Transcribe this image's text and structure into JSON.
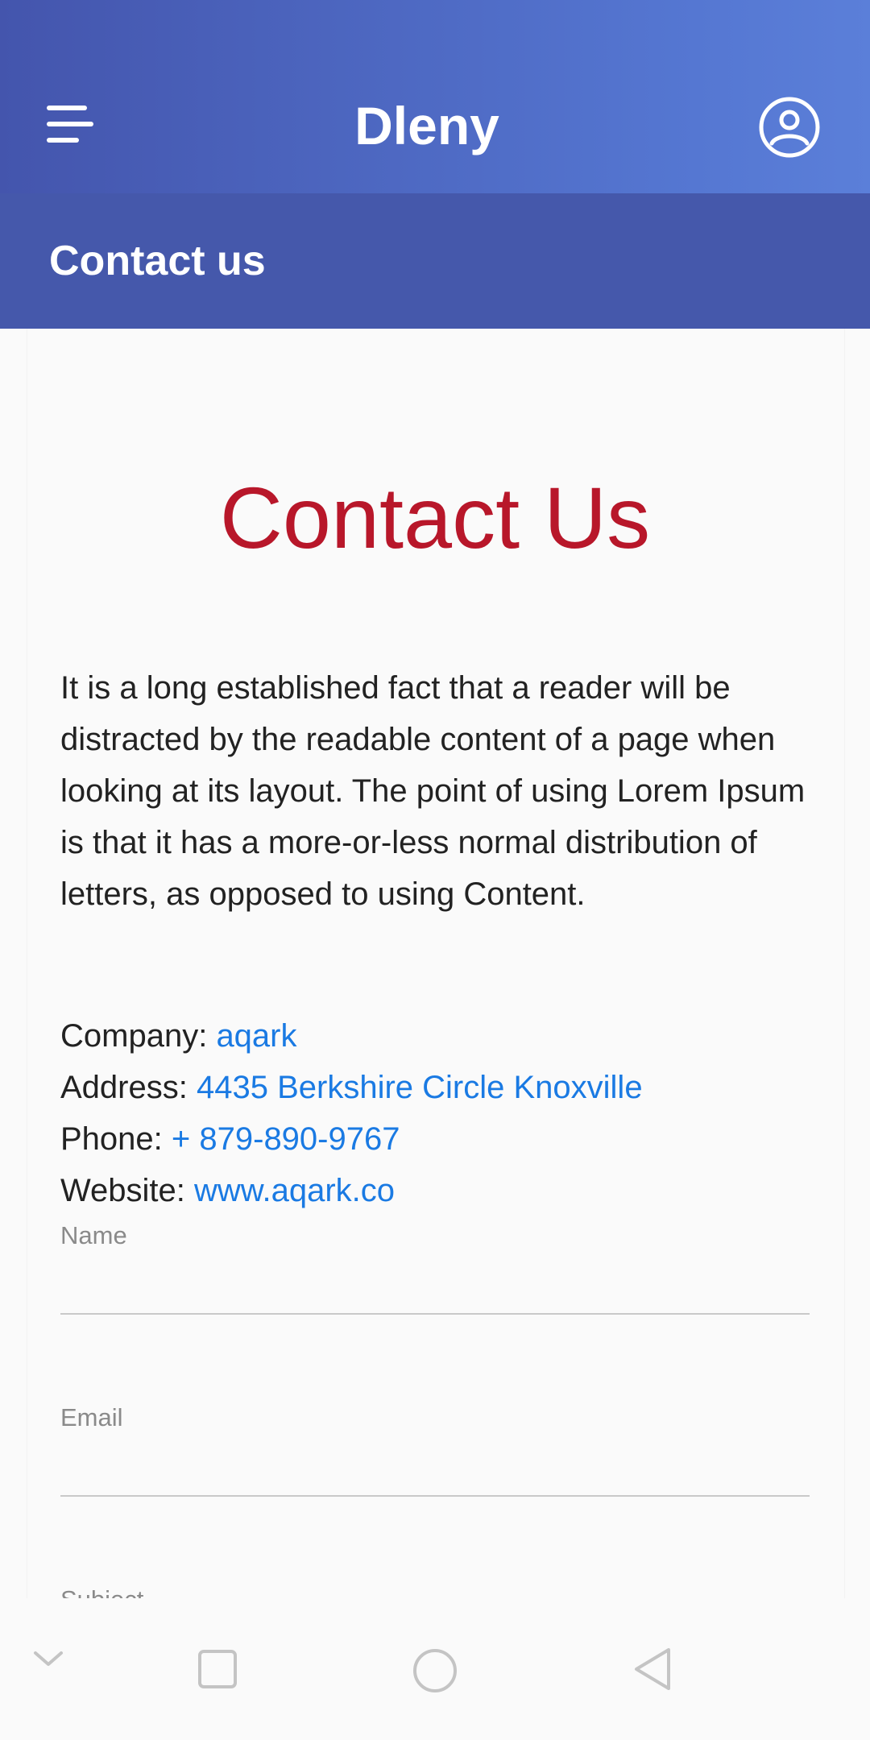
{
  "app": {
    "title": "Dleny",
    "header_colors": [
      "#4455ad",
      "#5b7fd9"
    ],
    "icons": {
      "menu": "hamburger-menu-icon",
      "profile": "user-profile-icon"
    }
  },
  "subheader": {
    "title": "Contact us",
    "color": "#4558ab"
  },
  "main": {
    "heading": "Contact Us",
    "heading_color": "#b8172a",
    "intro": "It is a long established fact that a reader will be distracted by the readable content of a page when looking at its layout. The point of using Lorem Ipsum is that it has a more-or-less normal distribution of letters, as opposed to using Content.",
    "info": [
      {
        "label": "Company:",
        "value": "aqark"
      },
      {
        "label": "Address:",
        "value": "4435 Berkshire Circle Knoxville"
      },
      {
        "label": "Phone:",
        "value": "+ 879-890-9767"
      },
      {
        "label": "Website:",
        "value": "www.aqark.co"
      }
    ],
    "link_color": "#1a7ae3"
  },
  "form": {
    "name_label": "Name",
    "name_value": "",
    "email_label": "Email",
    "email_value": "",
    "subject_label": "Subject"
  },
  "nav": {
    "icons": [
      "chevron-down-icon",
      "recent-apps-square-icon",
      "home-circle-icon",
      "back-triangle-icon"
    ]
  }
}
